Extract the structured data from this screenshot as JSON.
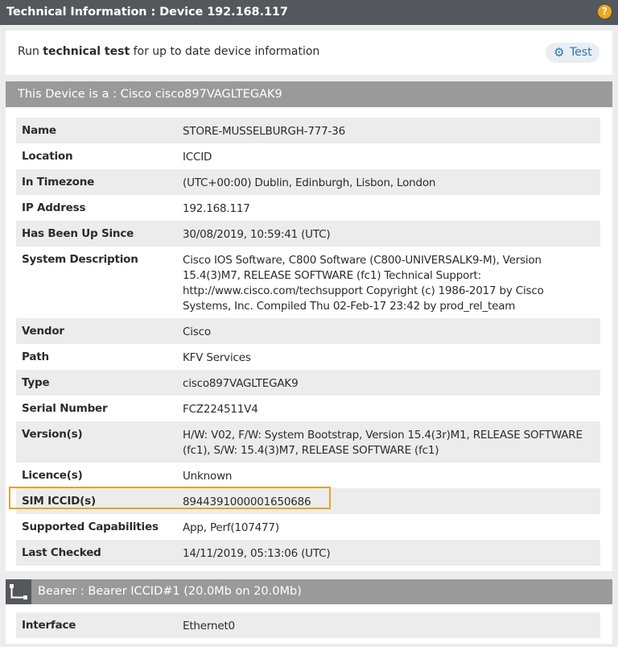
{
  "window": {
    "title": "Technical Information : Device 192.168.117",
    "help_glyph": "?"
  },
  "test_panel": {
    "msg_prefix": "Run ",
    "msg_bold": "technical test",
    "msg_suffix": " for up to date device information",
    "button_label": "Test"
  },
  "device": {
    "header": "This Device is a : Cisco cisco897VAGLTEGAK9",
    "rows": [
      {
        "label": "Name",
        "value": "STORE-MUSSELBURGH-777-36"
      },
      {
        "label": "Location",
        "value": "ICCID"
      },
      {
        "label": "In Timezone",
        "value": "(UTC+00:00) Dublin, Edinburgh, Lisbon, London"
      },
      {
        "label": "IP Address",
        "value": "192.168.117"
      },
      {
        "label": "Has Been Up Since",
        "value": "30/08/2019, 10:59:41 (UTC)"
      },
      {
        "label": "System Description",
        "value": "Cisco IOS Software, C800 Software (C800-UNIVERSALK9-M), Version 15.4(3)M7, RELEASE SOFTWARE (fc1) Technical Support: http://www.cisco.com/techsupport Copyright (c) 1986-2017 by Cisco Systems, Inc. Compiled Thu 02-Feb-17 23:42 by prod_rel_team"
      },
      {
        "label": "Vendor",
        "value": "Cisco"
      },
      {
        "label": "Path",
        "value": "KFV Services"
      },
      {
        "label": "Type",
        "value": "cisco897VAGLTEGAK9"
      },
      {
        "label": "Serial Number",
        "value": "FCZ224511V4"
      },
      {
        "label": "Version(s)",
        "value": "H/W: V02, F/W: System Bootstrap, Version 15.4(3r)M1, RELEASE SOFTWARE (fc1), S/W: 15.4(3)M7, RELEASE SOFTWARE (fc1)"
      },
      {
        "label": "Licence(s)",
        "value": "Unknown"
      },
      {
        "label": "SIM ICCID(s)",
        "value": "8944391000001650686"
      },
      {
        "label": "Supported Capabilities",
        "value": "App, Perf(107477)"
      },
      {
        "label": "Last Checked",
        "value": "14/11/2019, 05:13:06 (UTC)"
      }
    ]
  },
  "bearer": {
    "header": "Bearer : Bearer ICCID#1 (20.0Mb on 20.0Mb)",
    "rows": [
      {
        "label": "Interface",
        "value": "Ethernet0"
      }
    ]
  },
  "colors": {
    "titlebar": "#54575b",
    "section_header": "#9a9a9a",
    "accent": "#2e73b6",
    "highlight": "#e8a324",
    "help": "#f0a81c"
  }
}
